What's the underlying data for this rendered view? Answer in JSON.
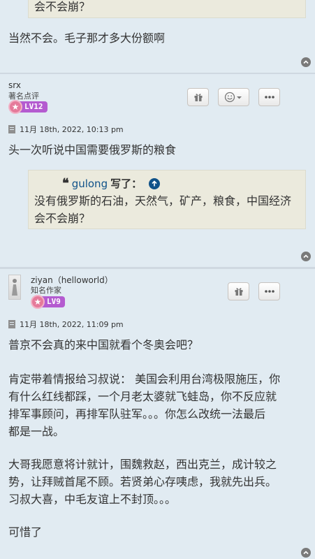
{
  "post1": {
    "quote_tail": "会不会崩？",
    "reply": "当然不会。毛子那才多大份额啊"
  },
  "post2": {
    "username": "srx",
    "rank": "著名点评",
    "level": "LV12",
    "timestamp": "11月 18th, 2022, 10:13 pm",
    "content": "头一次听说中国需要俄罗斯的粮食",
    "quote": {
      "author": "gulong",
      "wrote": "写了：",
      "line1": "没有俄罗斯的石油，天然气，矿产，粮食，中国经济",
      "line2": "会不会崩？"
    }
  },
  "post3": {
    "username": "ziyan（helloworld）",
    "rank": "知名作家",
    "level": "LV9",
    "timestamp": "11月 18th, 2022, 11:09 pm",
    "p1": "普京不会真的来中国就看个冬奥会吧？",
    "p2_l1": "肯定带着情报给习叔说： 美国会利用台湾极限施压，你",
    "p2_l2": "有什么红线都踩，一个月老太婆就飞蛙岛，你不反应就",
    "p2_l3": "排军事顾问，再排军队驻军。。。你怎么改统一法最后",
    "p2_l4": "都是一战。",
    "p3_l1": "大哥我愿意将计就计，围魏救赵，西出克兰，成计较之",
    "p3_l2": "势，让拜贼首尾不顾。若贤弟心存咦虑，我就先出兵。",
    "p3_l3": "习叔大喜，中毛友谊上不封顶。。。",
    "p4": "可惜了"
  },
  "colors": {
    "post_bg": "#e1ebf2",
    "quote_bg": "#ebeadd",
    "link": "#105289",
    "badge_purple": "#b45bd0",
    "badge_pink": "#e57a9a"
  }
}
